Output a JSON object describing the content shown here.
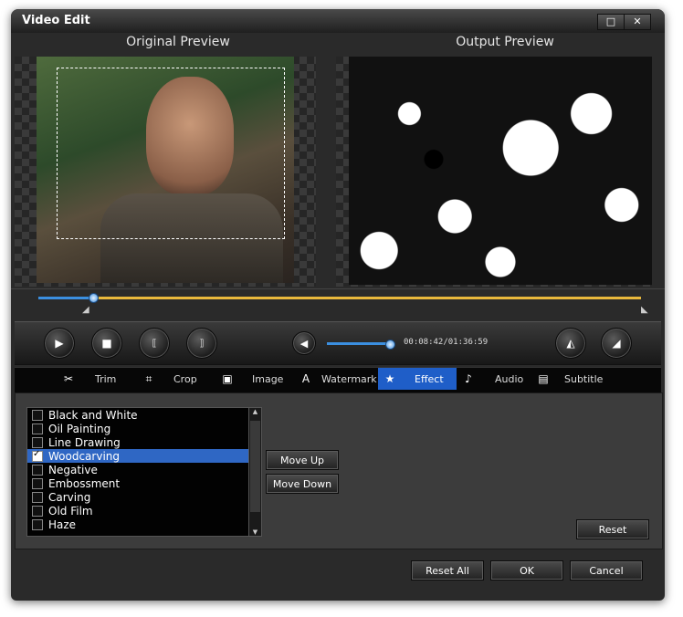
{
  "window": {
    "title": "Video Edit",
    "minimize": "□",
    "close": "✕"
  },
  "preview": {
    "original_label": "Original Preview",
    "output_label": "Output Preview"
  },
  "player": {
    "time": "00:08:42/01:36:59",
    "seek_progress": 0.09,
    "volume_level": 1.0
  },
  "tabs": [
    {
      "label": "Trim",
      "icon": "scissors-icon",
      "glyph": "✂"
    },
    {
      "label": "Crop",
      "icon": "crop-icon",
      "glyph": "⌗"
    },
    {
      "label": "Image",
      "icon": "image-icon",
      "glyph": "▣"
    },
    {
      "label": "Watermark",
      "icon": "watermark-icon",
      "glyph": "A"
    },
    {
      "label": "Effect",
      "icon": "star-icon",
      "glyph": "★"
    },
    {
      "label": "Audio",
      "icon": "music-note-icon",
      "glyph": "♪"
    },
    {
      "label": "Subtitle",
      "icon": "subtitle-icon",
      "glyph": "▤"
    }
  ],
  "effects": [
    {
      "label": "Black and White",
      "checked": false
    },
    {
      "label": "Oil Painting",
      "checked": false
    },
    {
      "label": "Line Drawing",
      "checked": false
    },
    {
      "label": "Woodcarving",
      "checked": true
    },
    {
      "label": "Negative",
      "checked": false
    },
    {
      "label": "Embossment",
      "checked": false
    },
    {
      "label": "Carving",
      "checked": false
    },
    {
      "label": "Old Film",
      "checked": false
    },
    {
      "label": "Haze",
      "checked": false
    }
  ],
  "effect_buttons": {
    "move_up": "Move Up",
    "move_down": "Move Down",
    "reset": "Reset"
  },
  "footer": {
    "reset_all": "Reset All",
    "ok": "OK",
    "cancel": "Cancel"
  },
  "colors": {
    "accent": "#1f5ec8",
    "seek_track": "#e8b83c",
    "seek_fill": "#3b8fe0"
  }
}
